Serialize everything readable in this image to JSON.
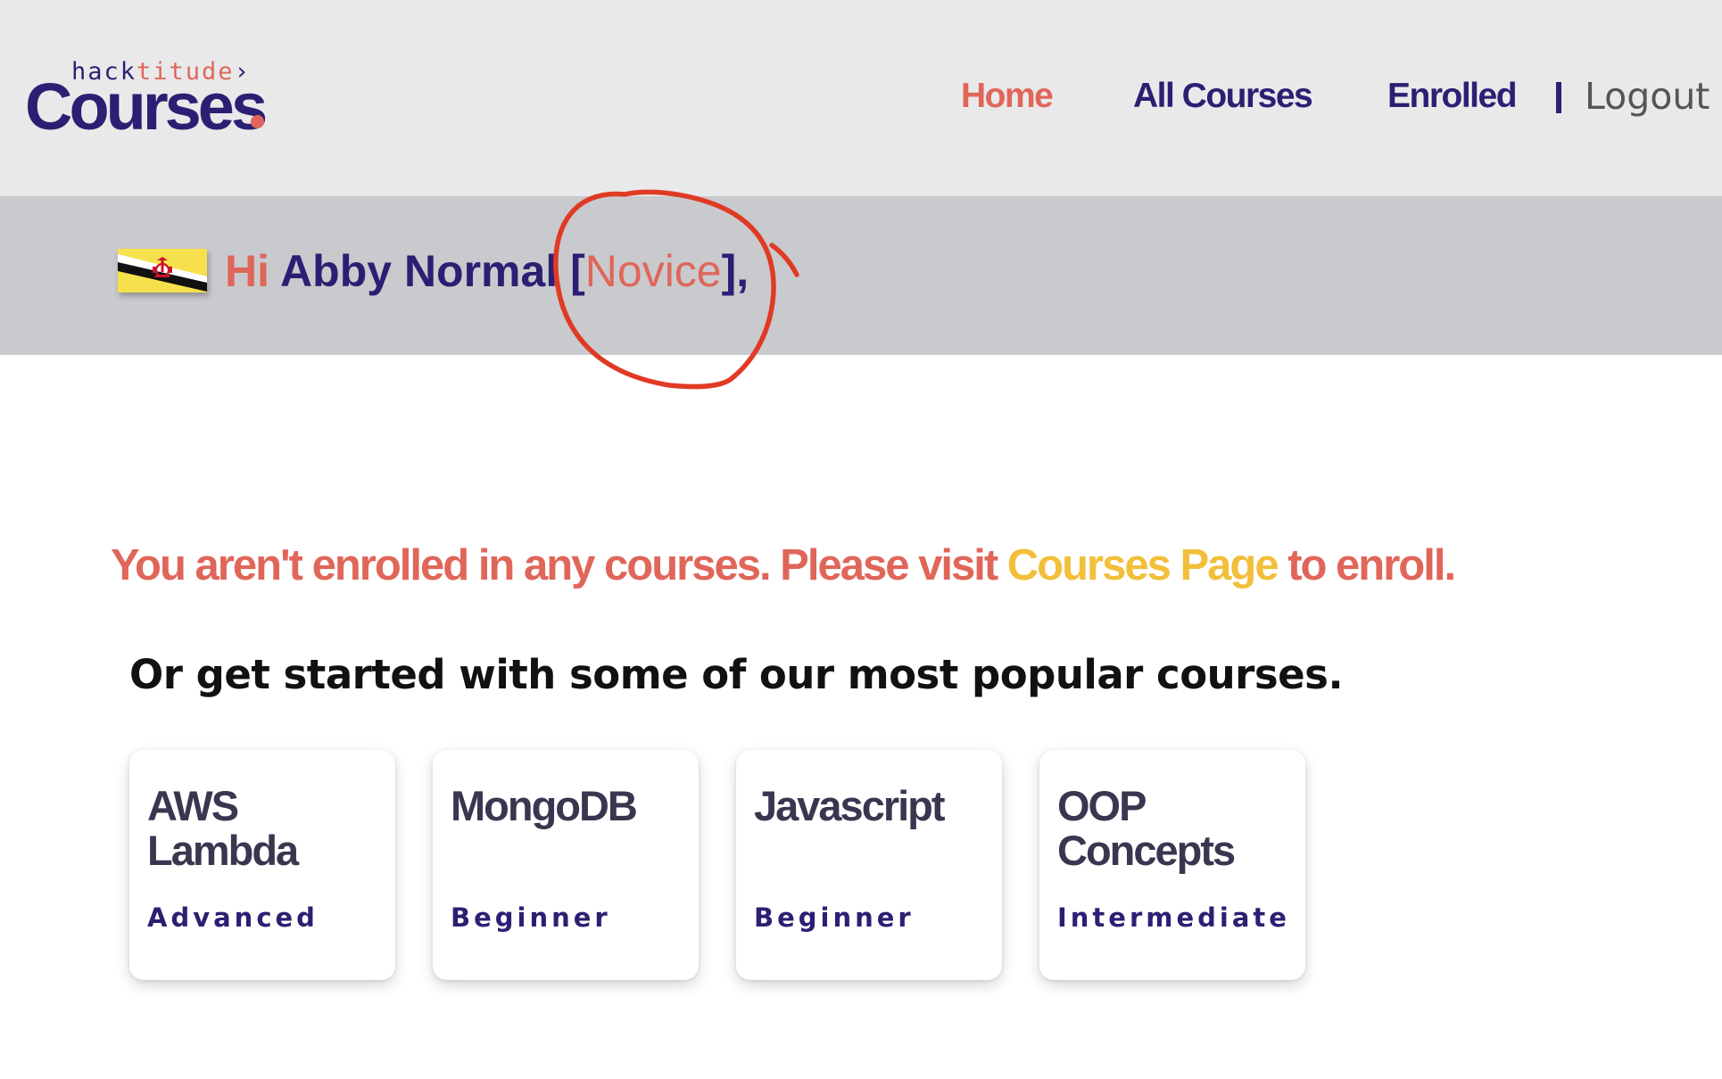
{
  "colors": {
    "brand_navy": "#2c1f73",
    "accent_coral": "#e0665a",
    "link_yellow": "#f2bf3a",
    "nav_background": "#e9e9ea",
    "banner_background": "#c9cacd",
    "annotation_red": "#e03a25"
  },
  "logo": {
    "small_part1": "hack",
    "small_part2": "titude",
    "small_chevron": "›",
    "big": "Courses"
  },
  "nav": {
    "home": "Home",
    "all_courses": "All Courses",
    "enrolled": "Enrolled",
    "separator": "|",
    "logout": "Logout"
  },
  "greeting": {
    "flag_icon": "brunei-flag-icon",
    "hi": "Hi",
    "name": "Abby Normal",
    "bracket_open": "[",
    "level": "Novice",
    "bracket_close": "],"
  },
  "notice": {
    "text_before": "You aren't enrolled in any courses. Please visit ",
    "link": "Courses Page",
    "text_after": " to enroll."
  },
  "popular": {
    "heading": "Or get started with some of our most popular courses.",
    "courses": [
      {
        "title": "AWS Lambda",
        "level": "Advanced"
      },
      {
        "title": "MongoDB",
        "level": "Beginner"
      },
      {
        "title": "Javascript",
        "level": "Beginner"
      },
      {
        "title": "OOP Concepts",
        "level": "Intermediate"
      }
    ]
  }
}
